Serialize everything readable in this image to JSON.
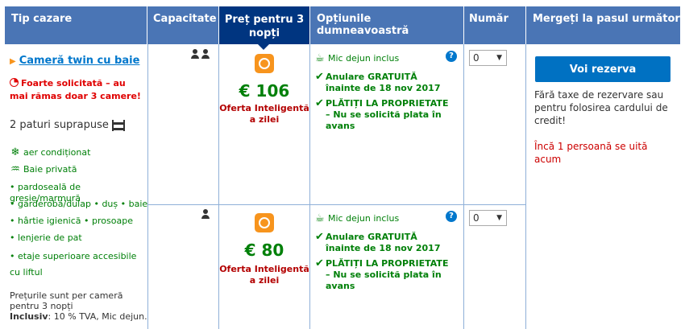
{
  "headers": {
    "room_type": "Tip cazare",
    "capacity": "Capacitate",
    "price": "Preț pentru 3 nopți",
    "options": "Opțiunile dumneavoastră",
    "number": "Număr",
    "next_step": "Mergeți la pasul următor"
  },
  "room": {
    "title": "Cameră twin cu baie",
    "urgency": "Foarte solicitată – au mai rămas doar 3 camere!",
    "beds": "2 paturi suprapuse",
    "facilities": [
      {
        "icon": "snowflake-icon",
        "text": "aer condiționat"
      },
      {
        "icon": "shower-icon",
        "text": "Baie privată"
      },
      {
        "icon": "",
        "text": "• pardoseală de gresie/marmură"
      },
      {
        "icon": "",
        "text": "• garderobă/dulap  • duș  • baie"
      },
      {
        "icon": "",
        "text": "• hârtie igienică  • prosoape"
      },
      {
        "icon": "",
        "text": "• lenjerie de pat"
      },
      {
        "icon": "",
        "text": "• etaje superioare accesibile cu liftul"
      }
    ],
    "prices_note": "Prețurile sunt per cameră pentru 3 nopți",
    "included_label": "Inclusiv",
    "included_value": ": 10 % TVA, Mic dejun."
  },
  "offers": [
    {
      "persons": 2,
      "price": "€ 106",
      "deal": "Oferta Inteligentă a zilei",
      "breakfast": "Mic dejun inclus",
      "cancel_title": "Anulare GRATUITĂ",
      "cancel_date": "înainte de 18 nov 2017",
      "pay_title": "PLĂTIȚI LA PROPRIETATE",
      "pay_detail": "– Nu se solicită plata în avans",
      "number_value": "0"
    },
    {
      "persons": 1,
      "price": "€ 80",
      "deal": "Oferta Inteligentă a zilei",
      "breakfast": "Mic dejun inclus",
      "cancel_title": "Anulare GRATUITĂ",
      "cancel_date": "înainte de 18 nov 2017",
      "pay_title": "PLĂTIȚI LA PROPRIETATE",
      "pay_detail": "– Nu se solicită plata în avans",
      "number_value": "0"
    }
  ],
  "reserve": {
    "button": "Voi rezerva",
    "no_fees": "Fără taxe de rezervare sau pentru folosirea cardului de credit!",
    "watching": "Încă 1 persoană se uită acum"
  },
  "colors": {
    "header_bg": "#4a75b5",
    "header_active_bg": "#003580",
    "green": "#008009",
    "red": "#e00000",
    "button": "#0071c2",
    "badge": "#f7941d"
  }
}
